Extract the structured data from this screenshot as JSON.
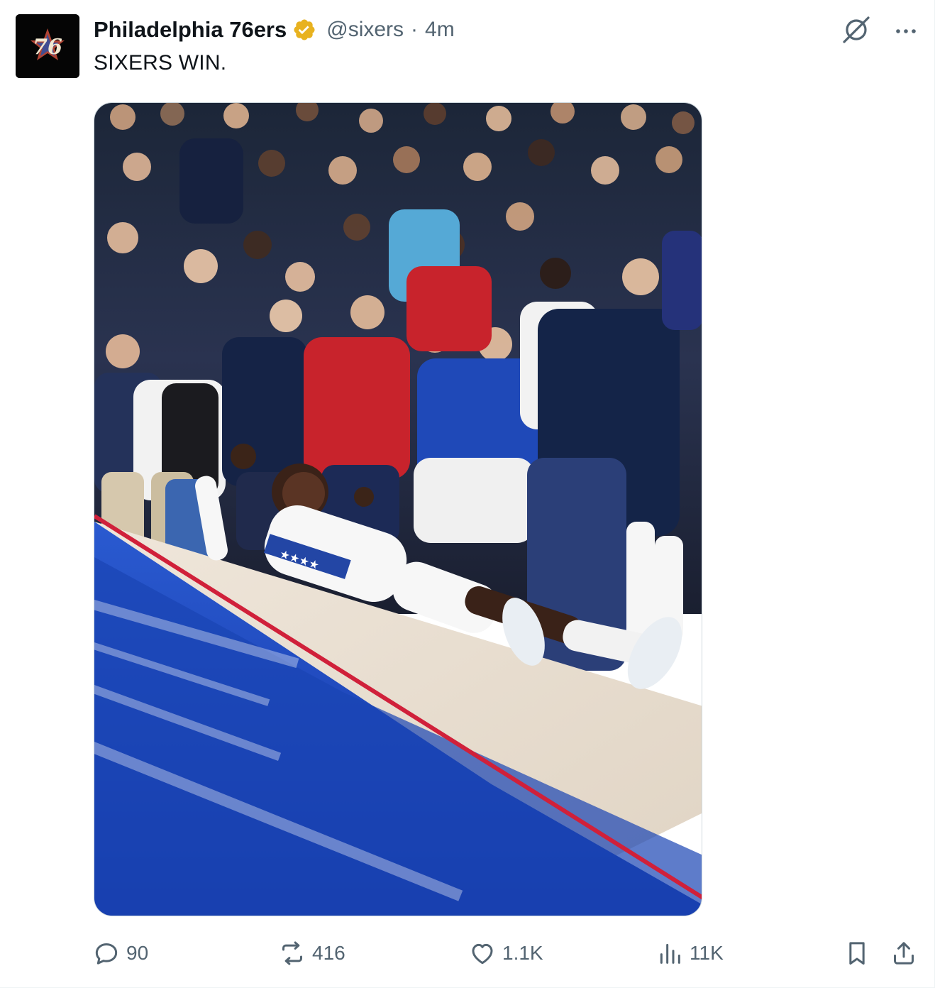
{
  "post": {
    "author": {
      "display_name": "Philadelphia 76ers",
      "handle": "@sixers",
      "verified_badge": "gold-check",
      "avatar_text": "76"
    },
    "separator": "·",
    "timestamp": "4m",
    "text": "SIXERS WIN.",
    "media": {
      "type": "photo",
      "jersey_text": "★★★★"
    },
    "metrics": {
      "replies": "90",
      "reposts": "416",
      "likes": "1.1K",
      "views": "11K"
    },
    "icons": {
      "top": [
        "grok-icon",
        "more-icon"
      ],
      "actions": [
        "reply-icon",
        "repost-icon",
        "like-icon",
        "views-icon",
        "bookmark-icon",
        "share-icon"
      ]
    },
    "colors": {
      "text_primary": "#0f1419",
      "text_secondary": "#536471",
      "verified_gold": "#e8b21f",
      "court_blue": "#1a46b8",
      "court_red": "#d0203a"
    }
  }
}
